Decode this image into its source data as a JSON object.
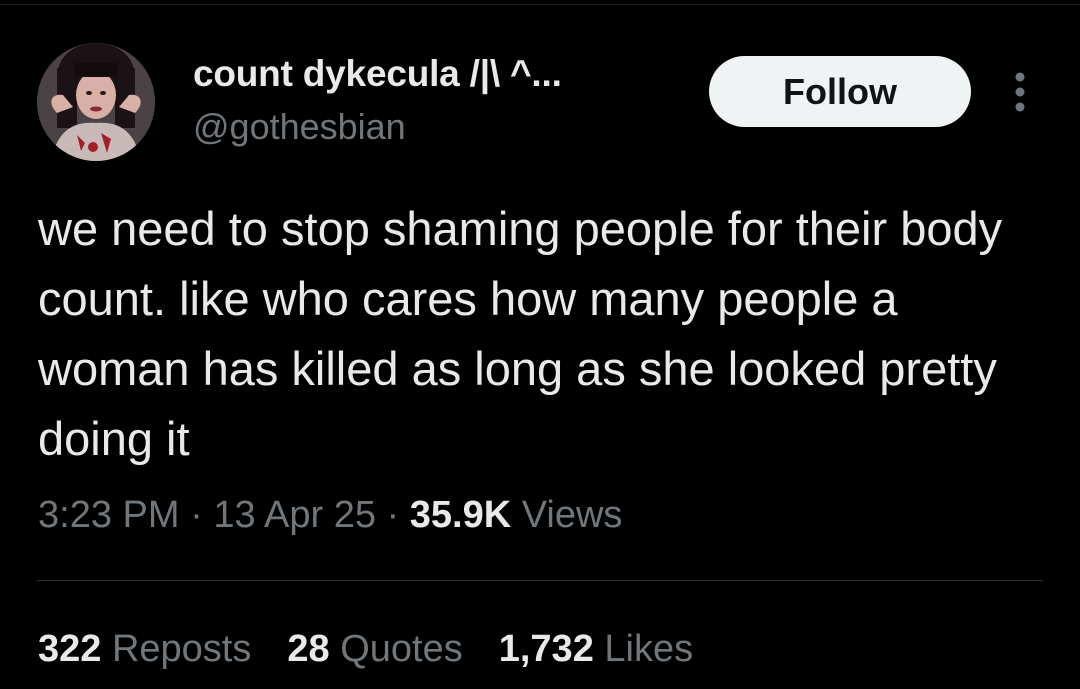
{
  "user": {
    "display_name": "count dykecula /|\\ ^...",
    "handle": "@gothesbian"
  },
  "follow_button": {
    "label": "Follow"
  },
  "tweet": {
    "text": "we need to stop shaming people for their body count. like who cares how many people a woman has killed as long as she looked pretty doing it"
  },
  "meta": {
    "time": "3:23 PM",
    "sep1": " · ",
    "date": "13 Apr 25",
    "sep2": " · ",
    "views_count": "35.9K",
    "views_label": " Views"
  },
  "stats": {
    "reposts": {
      "count": "322",
      "label": " Reposts"
    },
    "quotes": {
      "count": "28",
      "label": " Quotes"
    },
    "likes": {
      "count": "1,732",
      "label": " Likes"
    }
  },
  "icons": {
    "more": "more-dots-vertical-icon"
  },
  "colors": {
    "background": "#000000",
    "primary_text": "#e7e9ea",
    "secondary_text": "#71767b",
    "follow_bg": "#eff3f4",
    "divider": "#2f3336"
  }
}
